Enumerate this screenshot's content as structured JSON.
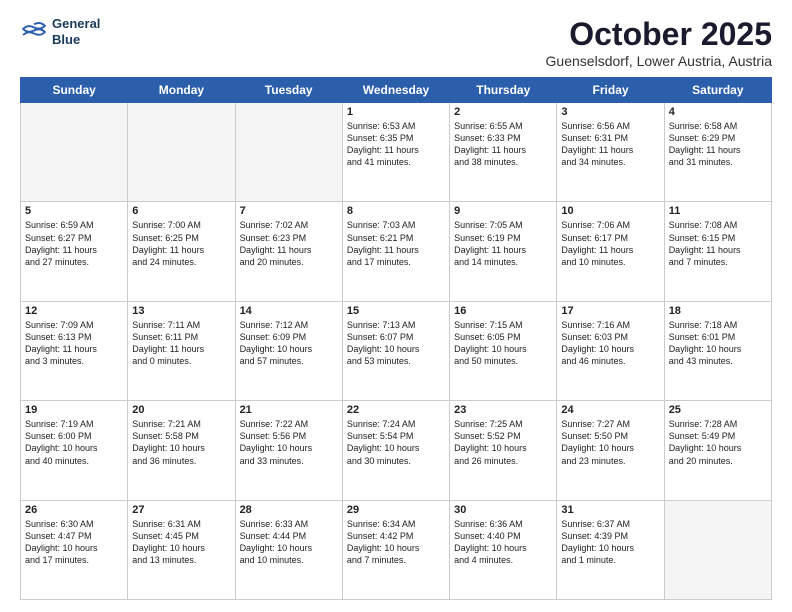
{
  "header": {
    "logo_line1": "General",
    "logo_line2": "Blue",
    "month": "October 2025",
    "location": "Guenselsdorf, Lower Austria, Austria"
  },
  "days_of_week": [
    "Sunday",
    "Monday",
    "Tuesday",
    "Wednesday",
    "Thursday",
    "Friday",
    "Saturday"
  ],
  "weeks": [
    [
      {
        "day": "",
        "info": ""
      },
      {
        "day": "",
        "info": ""
      },
      {
        "day": "",
        "info": ""
      },
      {
        "day": "1",
        "info": "Sunrise: 6:53 AM\nSunset: 6:35 PM\nDaylight: 11 hours\nand 41 minutes."
      },
      {
        "day": "2",
        "info": "Sunrise: 6:55 AM\nSunset: 6:33 PM\nDaylight: 11 hours\nand 38 minutes."
      },
      {
        "day": "3",
        "info": "Sunrise: 6:56 AM\nSunset: 6:31 PM\nDaylight: 11 hours\nand 34 minutes."
      },
      {
        "day": "4",
        "info": "Sunrise: 6:58 AM\nSunset: 6:29 PM\nDaylight: 11 hours\nand 31 minutes."
      }
    ],
    [
      {
        "day": "5",
        "info": "Sunrise: 6:59 AM\nSunset: 6:27 PM\nDaylight: 11 hours\nand 27 minutes."
      },
      {
        "day": "6",
        "info": "Sunrise: 7:00 AM\nSunset: 6:25 PM\nDaylight: 11 hours\nand 24 minutes."
      },
      {
        "day": "7",
        "info": "Sunrise: 7:02 AM\nSunset: 6:23 PM\nDaylight: 11 hours\nand 20 minutes."
      },
      {
        "day": "8",
        "info": "Sunrise: 7:03 AM\nSunset: 6:21 PM\nDaylight: 11 hours\nand 17 minutes."
      },
      {
        "day": "9",
        "info": "Sunrise: 7:05 AM\nSunset: 6:19 PM\nDaylight: 11 hours\nand 14 minutes."
      },
      {
        "day": "10",
        "info": "Sunrise: 7:06 AM\nSunset: 6:17 PM\nDaylight: 11 hours\nand 10 minutes."
      },
      {
        "day": "11",
        "info": "Sunrise: 7:08 AM\nSunset: 6:15 PM\nDaylight: 11 hours\nand 7 minutes."
      }
    ],
    [
      {
        "day": "12",
        "info": "Sunrise: 7:09 AM\nSunset: 6:13 PM\nDaylight: 11 hours\nand 3 minutes."
      },
      {
        "day": "13",
        "info": "Sunrise: 7:11 AM\nSunset: 6:11 PM\nDaylight: 11 hours\nand 0 minutes."
      },
      {
        "day": "14",
        "info": "Sunrise: 7:12 AM\nSunset: 6:09 PM\nDaylight: 10 hours\nand 57 minutes."
      },
      {
        "day": "15",
        "info": "Sunrise: 7:13 AM\nSunset: 6:07 PM\nDaylight: 10 hours\nand 53 minutes."
      },
      {
        "day": "16",
        "info": "Sunrise: 7:15 AM\nSunset: 6:05 PM\nDaylight: 10 hours\nand 50 minutes."
      },
      {
        "day": "17",
        "info": "Sunrise: 7:16 AM\nSunset: 6:03 PM\nDaylight: 10 hours\nand 46 minutes."
      },
      {
        "day": "18",
        "info": "Sunrise: 7:18 AM\nSunset: 6:01 PM\nDaylight: 10 hours\nand 43 minutes."
      }
    ],
    [
      {
        "day": "19",
        "info": "Sunrise: 7:19 AM\nSunset: 6:00 PM\nDaylight: 10 hours\nand 40 minutes."
      },
      {
        "day": "20",
        "info": "Sunrise: 7:21 AM\nSunset: 5:58 PM\nDaylight: 10 hours\nand 36 minutes."
      },
      {
        "day": "21",
        "info": "Sunrise: 7:22 AM\nSunset: 5:56 PM\nDaylight: 10 hours\nand 33 minutes."
      },
      {
        "day": "22",
        "info": "Sunrise: 7:24 AM\nSunset: 5:54 PM\nDaylight: 10 hours\nand 30 minutes."
      },
      {
        "day": "23",
        "info": "Sunrise: 7:25 AM\nSunset: 5:52 PM\nDaylight: 10 hours\nand 26 minutes."
      },
      {
        "day": "24",
        "info": "Sunrise: 7:27 AM\nSunset: 5:50 PM\nDaylight: 10 hours\nand 23 minutes."
      },
      {
        "day": "25",
        "info": "Sunrise: 7:28 AM\nSunset: 5:49 PM\nDaylight: 10 hours\nand 20 minutes."
      }
    ],
    [
      {
        "day": "26",
        "info": "Sunrise: 6:30 AM\nSunset: 4:47 PM\nDaylight: 10 hours\nand 17 minutes."
      },
      {
        "day": "27",
        "info": "Sunrise: 6:31 AM\nSunset: 4:45 PM\nDaylight: 10 hours\nand 13 minutes."
      },
      {
        "day": "28",
        "info": "Sunrise: 6:33 AM\nSunset: 4:44 PM\nDaylight: 10 hours\nand 10 minutes."
      },
      {
        "day": "29",
        "info": "Sunrise: 6:34 AM\nSunset: 4:42 PM\nDaylight: 10 hours\nand 7 minutes."
      },
      {
        "day": "30",
        "info": "Sunrise: 6:36 AM\nSunset: 4:40 PM\nDaylight: 10 hours\nand 4 minutes."
      },
      {
        "day": "31",
        "info": "Sunrise: 6:37 AM\nSunset: 4:39 PM\nDaylight: 10 hours\nand 1 minute."
      },
      {
        "day": "",
        "info": ""
      }
    ]
  ]
}
